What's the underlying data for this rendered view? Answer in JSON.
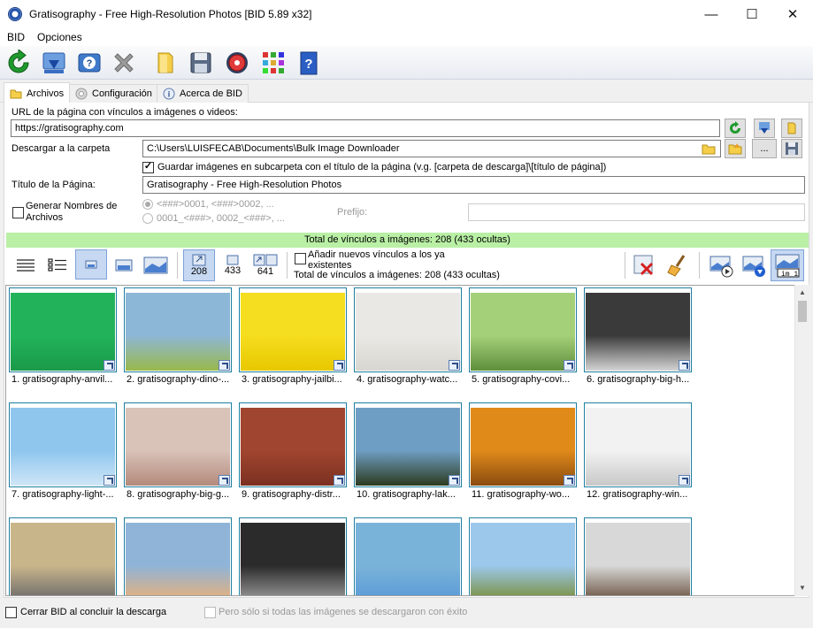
{
  "window": {
    "title": "Gratisography - Free High-Resolution Photos [BID 5.89 x32]",
    "minimize": "—",
    "maximize": "☐",
    "close": "✕"
  },
  "menu": [
    "BID",
    "Opciones"
  ],
  "toolbar": {
    "icons": [
      "refresh-icon",
      "download-icon",
      "help-icon",
      "stop-icon",
      "folder-icon",
      "save-icon",
      "settings-icon",
      "grid-icon",
      "manual-icon"
    ]
  },
  "tabs": [
    {
      "label": "Archivos",
      "icon": "folder-icon",
      "active": true
    },
    {
      "label": "Configuración",
      "icon": "gear-icon",
      "active": false
    },
    {
      "label": "Acerca de BID",
      "icon": "info-icon",
      "active": false
    }
  ],
  "form": {
    "url_label": "URL de la página con vínculos a imágenes o videos:",
    "url_value": "https://gratisography.com",
    "folder_label": "Descargar a la carpeta",
    "folder_value": "C:\\Users\\LUISFECAB\\Documents\\Bulk Image Downloader",
    "more_button": "...",
    "subfolder_checkbox_label": "Guardar imágenes en subcarpeta con el título de la página (v.g. [carpeta de descarga]\\[título de página])",
    "title_label": "Título de la Página:",
    "title_value": "Gratisography - Free High-Resolution Photos",
    "generate_names_label_line1": "Generar Nombres de",
    "generate_names_label_line2": "Archivos",
    "radio1_label": "<###>0001, <###>0002, ...",
    "radio2_label": "0001_<###>, 0002_<###>, ...",
    "prefix_label": "Prefijo:",
    "prefix_value": ""
  },
  "status": {
    "total_links": "Total de vínculos a imágenes: 208 (433 ocultas)"
  },
  "viewbar": {
    "filter_counts": [
      "208",
      "433",
      "641"
    ],
    "add_links_label_line1": "Añadir nuevos vínculos a los ya",
    "add_links_label_line2": "existentes",
    "total_links": "Total de vínculos a imágenes: 208 (433 ocultas)",
    "rename_chip": "im_1"
  },
  "thumbnails": [
    {
      "caption": "1. gratisography-anvil...",
      "colors": [
        "#22b35a",
        "#1a9a4a"
      ]
    },
    {
      "caption": "2. gratisography-dino-...",
      "colors": [
        "#8db7d6",
        "#9ab84a"
      ]
    },
    {
      "caption": "3. gratisography-jailbi...",
      "colors": [
        "#f5dd1f",
        "#e8c800"
      ]
    },
    {
      "caption": "4. gratisography-watc...",
      "colors": [
        "#e9e8e4",
        "#d8d6d0"
      ]
    },
    {
      "caption": "5. gratisography-covi...",
      "colors": [
        "#a5d07a",
        "#5f8f3b"
      ]
    },
    {
      "caption": "6. gratisography-big-h...",
      "colors": [
        "#3a3a3a",
        "#d4d4d4"
      ]
    },
    {
      "caption": "7. gratisography-light-...",
      "colors": [
        "#8fc6ee",
        "#cfe6f7"
      ]
    },
    {
      "caption": "8. gratisography-big-g...",
      "colors": [
        "#d9c2b8",
        "#b38a7c"
      ]
    },
    {
      "caption": "9. gratisography-distr...",
      "colors": [
        "#a0452f",
        "#7c3022"
      ]
    },
    {
      "caption": "10. gratisography-lak...",
      "colors": [
        "#6f9ec4",
        "#2c3b1f"
      ]
    },
    {
      "caption": "11. gratisography-wo...",
      "colors": [
        "#e08a1a",
        "#8a4c10"
      ]
    },
    {
      "caption": "12. gratisography-win...",
      "colors": [
        "#f2f2f2",
        "#c8c8c8"
      ]
    },
    {
      "caption": "",
      "colors": [
        "#c9b58a",
        "#6a6a6a"
      ]
    },
    {
      "caption": "",
      "colors": [
        "#8fb4d8",
        "#e8b07a"
      ]
    },
    {
      "caption": "",
      "colors": [
        "#2b2b2b",
        "#9a9a9a"
      ]
    },
    {
      "caption": "",
      "colors": [
        "#7ab3d9",
        "#5a9ad8"
      ]
    },
    {
      "caption": "",
      "colors": [
        "#9cc8ec",
        "#7a8f3a"
      ]
    },
    {
      "caption": "",
      "colors": [
        "#d8d8d8",
        "#6a5240"
      ]
    }
  ],
  "footer": {
    "close_checkbox_label": "Cerrar BID al concluir la descarga",
    "only_if_success_label": "Pero sólo si todas las imágenes se descargaron con éxito"
  }
}
